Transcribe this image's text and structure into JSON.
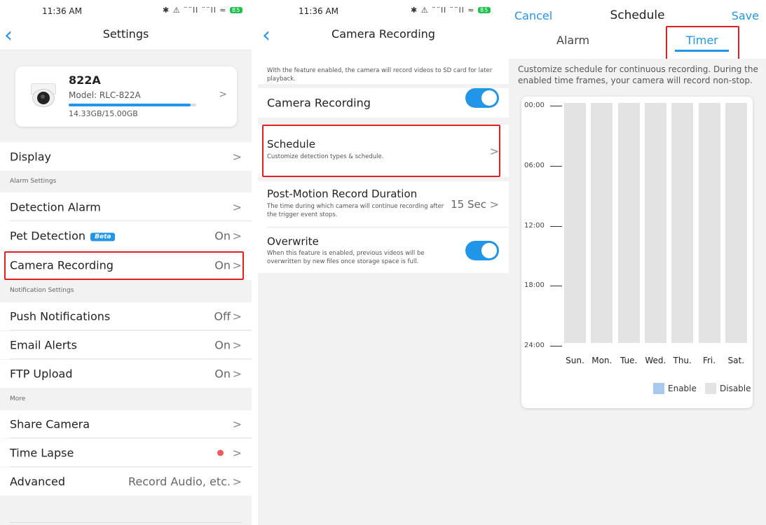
{
  "settings": {
    "status_time": "11:36 AM",
    "status_icons": "✱ ⚠ ¨¨ll ¨¨ll ≈",
    "battery": "85",
    "title": "Settings",
    "device": {
      "name": "822A",
      "model": "Model: RLC-822A",
      "storage": "14.33GB/15.00GB",
      "storage_fraction": 0.955
    },
    "display": "Display",
    "section_alarm": "Alarm Settings",
    "detection_alarm": "Detection Alarm",
    "pet_detection": "Pet Detection",
    "beta": "Beta",
    "pet_value": "On",
    "camera_recording": "Camera Recording",
    "camera_recording_value": "On",
    "section_notif": "Notification Settings",
    "push_notifications": "Push Notifications",
    "push_value": "Off",
    "email_alerts": "Email Alerts",
    "email_value": "On",
    "ftp_upload": "FTP Upload",
    "ftp_value": "On",
    "section_more": "More",
    "share_camera": "Share Camera",
    "time_lapse": "Time Lapse",
    "advanced": "Advanced",
    "advanced_value": "Record Audio, etc.",
    "chevron": ">"
  },
  "recording": {
    "status_time": "11:36 AM",
    "title": "Camera Recording",
    "intro": "With the feature enabled, the camera will record videos to SD card for later playback.",
    "camera_recording": "Camera Recording",
    "schedule": "Schedule",
    "schedule_sub": "Customize detection types & schedule.",
    "post_motion": "Post-Motion Record Duration",
    "post_motion_sub": "The time during which camera will continue recording after the trigger event stops.",
    "post_motion_value": "15 Sec",
    "overwrite": "Overwrite",
    "overwrite_sub": "When this feature is enabled, previous videos will be overwritten by new files once storage space is full."
  },
  "schedule": {
    "cancel": "Cancel",
    "title": "Schedule",
    "save": "Save",
    "tab_alarm": "Alarm",
    "tab_timer": "Timer",
    "description": "Customize schedule for continuous recording. During the enabled time frames, your camera will record non-stop.",
    "times": [
      "00:00",
      "06:00",
      "12:00",
      "18:00",
      "24:00"
    ],
    "days": [
      "Sun.",
      "Mon.",
      "Tue.",
      "Wed.",
      "Thu.",
      "Fri.",
      "Sat."
    ],
    "legend_enable": "Enable",
    "legend_disable": "Disable",
    "colors": {
      "accent": "#2196e8",
      "enable": "#a8c8f0",
      "disable": "#e3e3e3",
      "highlight": "#e02020"
    }
  }
}
